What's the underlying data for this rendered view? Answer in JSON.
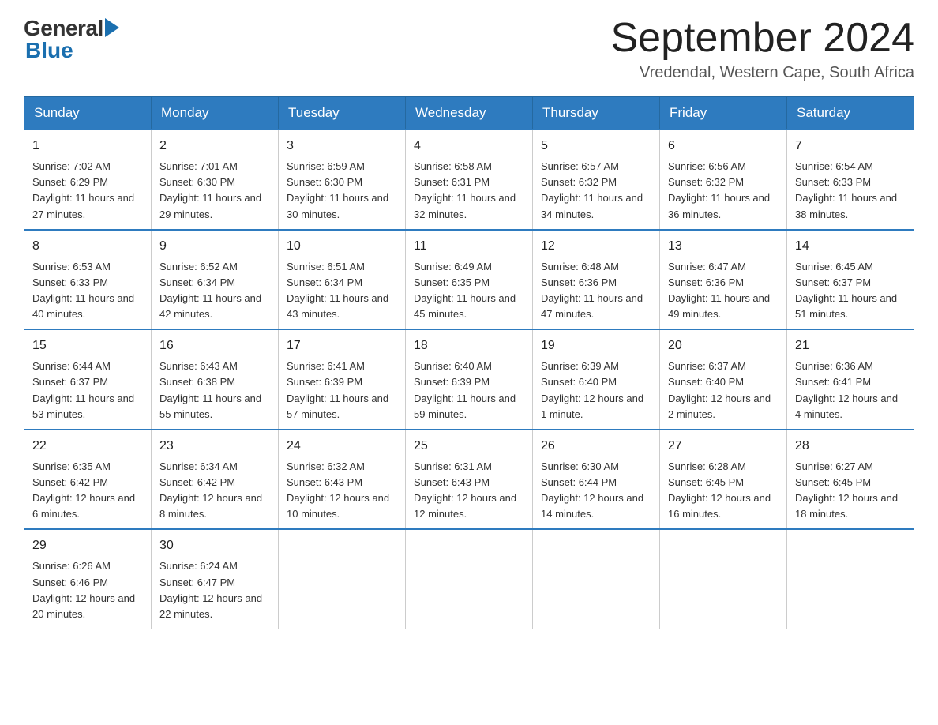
{
  "header": {
    "logo_general": "General",
    "logo_blue": "Blue",
    "month_title": "September 2024",
    "location": "Vredendal, Western Cape, South Africa"
  },
  "weekdays": [
    "Sunday",
    "Monday",
    "Tuesday",
    "Wednesday",
    "Thursday",
    "Friday",
    "Saturday"
  ],
  "weeks": [
    [
      {
        "day": "1",
        "sunrise": "7:02 AM",
        "sunset": "6:29 PM",
        "daylight": "11 hours and 27 minutes."
      },
      {
        "day": "2",
        "sunrise": "7:01 AM",
        "sunset": "6:30 PM",
        "daylight": "11 hours and 29 minutes."
      },
      {
        "day": "3",
        "sunrise": "6:59 AM",
        "sunset": "6:30 PM",
        "daylight": "11 hours and 30 minutes."
      },
      {
        "day": "4",
        "sunrise": "6:58 AM",
        "sunset": "6:31 PM",
        "daylight": "11 hours and 32 minutes."
      },
      {
        "day": "5",
        "sunrise": "6:57 AM",
        "sunset": "6:32 PM",
        "daylight": "11 hours and 34 minutes."
      },
      {
        "day": "6",
        "sunrise": "6:56 AM",
        "sunset": "6:32 PM",
        "daylight": "11 hours and 36 minutes."
      },
      {
        "day": "7",
        "sunrise": "6:54 AM",
        "sunset": "6:33 PM",
        "daylight": "11 hours and 38 minutes."
      }
    ],
    [
      {
        "day": "8",
        "sunrise": "6:53 AM",
        "sunset": "6:33 PM",
        "daylight": "11 hours and 40 minutes."
      },
      {
        "day": "9",
        "sunrise": "6:52 AM",
        "sunset": "6:34 PM",
        "daylight": "11 hours and 42 minutes."
      },
      {
        "day": "10",
        "sunrise": "6:51 AM",
        "sunset": "6:34 PM",
        "daylight": "11 hours and 43 minutes."
      },
      {
        "day": "11",
        "sunrise": "6:49 AM",
        "sunset": "6:35 PM",
        "daylight": "11 hours and 45 minutes."
      },
      {
        "day": "12",
        "sunrise": "6:48 AM",
        "sunset": "6:36 PM",
        "daylight": "11 hours and 47 minutes."
      },
      {
        "day": "13",
        "sunrise": "6:47 AM",
        "sunset": "6:36 PM",
        "daylight": "11 hours and 49 minutes."
      },
      {
        "day": "14",
        "sunrise": "6:45 AM",
        "sunset": "6:37 PM",
        "daylight": "11 hours and 51 minutes."
      }
    ],
    [
      {
        "day": "15",
        "sunrise": "6:44 AM",
        "sunset": "6:37 PM",
        "daylight": "11 hours and 53 minutes."
      },
      {
        "day": "16",
        "sunrise": "6:43 AM",
        "sunset": "6:38 PM",
        "daylight": "11 hours and 55 minutes."
      },
      {
        "day": "17",
        "sunrise": "6:41 AM",
        "sunset": "6:39 PM",
        "daylight": "11 hours and 57 minutes."
      },
      {
        "day": "18",
        "sunrise": "6:40 AM",
        "sunset": "6:39 PM",
        "daylight": "11 hours and 59 minutes."
      },
      {
        "day": "19",
        "sunrise": "6:39 AM",
        "sunset": "6:40 PM",
        "daylight": "12 hours and 1 minute."
      },
      {
        "day": "20",
        "sunrise": "6:37 AM",
        "sunset": "6:40 PM",
        "daylight": "12 hours and 2 minutes."
      },
      {
        "day": "21",
        "sunrise": "6:36 AM",
        "sunset": "6:41 PM",
        "daylight": "12 hours and 4 minutes."
      }
    ],
    [
      {
        "day": "22",
        "sunrise": "6:35 AM",
        "sunset": "6:42 PM",
        "daylight": "12 hours and 6 minutes."
      },
      {
        "day": "23",
        "sunrise": "6:34 AM",
        "sunset": "6:42 PM",
        "daylight": "12 hours and 8 minutes."
      },
      {
        "day": "24",
        "sunrise": "6:32 AM",
        "sunset": "6:43 PM",
        "daylight": "12 hours and 10 minutes."
      },
      {
        "day": "25",
        "sunrise": "6:31 AM",
        "sunset": "6:43 PM",
        "daylight": "12 hours and 12 minutes."
      },
      {
        "day": "26",
        "sunrise": "6:30 AM",
        "sunset": "6:44 PM",
        "daylight": "12 hours and 14 minutes."
      },
      {
        "day": "27",
        "sunrise": "6:28 AM",
        "sunset": "6:45 PM",
        "daylight": "12 hours and 16 minutes."
      },
      {
        "day": "28",
        "sunrise": "6:27 AM",
        "sunset": "6:45 PM",
        "daylight": "12 hours and 18 minutes."
      }
    ],
    [
      {
        "day": "29",
        "sunrise": "6:26 AM",
        "sunset": "6:46 PM",
        "daylight": "12 hours and 20 minutes."
      },
      {
        "day": "30",
        "sunrise": "6:24 AM",
        "sunset": "6:47 PM",
        "daylight": "12 hours and 22 minutes."
      },
      null,
      null,
      null,
      null,
      null
    ]
  ],
  "labels": {
    "sunrise": "Sunrise:",
    "sunset": "Sunset:",
    "daylight": "Daylight:"
  }
}
